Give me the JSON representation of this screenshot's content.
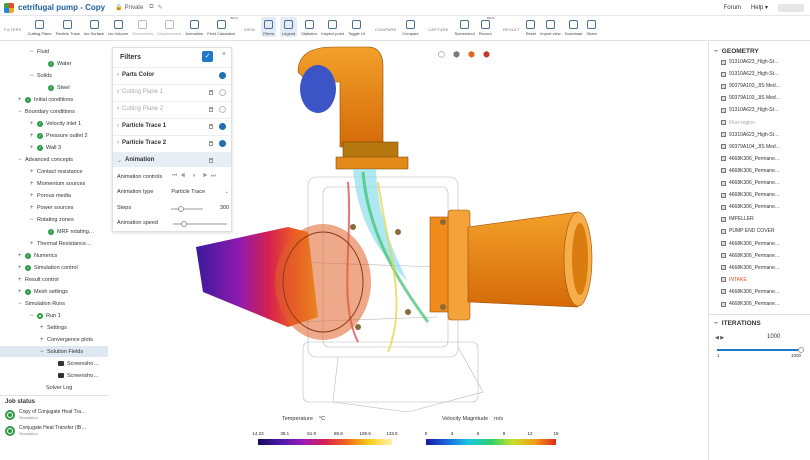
{
  "app": {
    "title": "cetrifugal pump - Copy",
    "privacy": "Private",
    "forum": "Forum",
    "help": "Help ▾"
  },
  "toolbar": {
    "filters_label": "FILTERS",
    "filters": [
      "Cutting Plane",
      "Particle Trace",
      "Iso Surface",
      "Iso Volume",
      "Streamlines",
      "Displacement",
      "Animation",
      "Field Calculator"
    ],
    "view_label": "VIEW",
    "view": [
      "Filters",
      "Legend",
      "Statistics",
      "Inspect point",
      "Toggle UI"
    ],
    "compare_label": "COMPARE",
    "compare": [
      "Compare"
    ],
    "capture_label": "CAPTURE",
    "capture": [
      "Screenshot",
      "Record"
    ],
    "result_label": "RESULT",
    "result": [
      "Reset",
      "Import view",
      "Download",
      "Share"
    ],
    "beta": "BETA"
  },
  "tree": [
    "Fluid",
    "Water",
    "Solids",
    "Steel",
    "Initial conditions",
    "Boundary conditions",
    "Velocity inlet 1",
    "Pressure outlet 2",
    "Wall 3",
    "Advanced concepts",
    "Contact resistance",
    "Momentum sources",
    "Porous media",
    "Power sources",
    "Rotating zones",
    "MRF rotating…",
    "Thermal Resistance…",
    "Numerics",
    "Simulation control",
    "Result control",
    "Mesh settings",
    "Simulation Runs",
    "Run 1",
    "Settings",
    "Convergence plots",
    "Solution Fields",
    "Screensho…",
    "Screensho…",
    "Solver Log"
  ],
  "jobs": {
    "title": "Job status",
    "items": [
      {
        "name": "Copy of Conjugate Heat Tra…",
        "type": "Simulation"
      },
      {
        "name": "Conjugate Heat Transfer (IB…",
        "type": "Simulation"
      }
    ]
  },
  "filters_panel": {
    "title": "Filters",
    "ok": "✓",
    "close": "×",
    "rows": [
      "Parts Color",
      "Cutting Plane 1",
      "Cutting Plane 2",
      "Particle Trace 1",
      "Particle Trace 2",
      "Animation"
    ],
    "animation_controls": "Animation controls",
    "animation_type_label": "Animation type",
    "animation_type": "Particle Trace",
    "steps_label": "Steps",
    "steps": "300",
    "steps_fraction": 0.3,
    "speed_label": "Animation speed",
    "speed_fraction": 0.2
  },
  "geometry": {
    "title": "GEOMETRY",
    "items": [
      "91310A623_High-St…",
      "91310A623_High-St…",
      "90379A103_JIS Med…",
      "90379A103_JIS Med…",
      "91310A623_High-St…",
      "Flow region",
      "91310A623_High-St…",
      "90379A104_JIS Med…",
      "4668K306_Permane…",
      "4668K306_Permane…",
      "4668K306_Permane…",
      "4668K306_Permane…",
      "4668K306_Permane…",
      "IMPELLER",
      "PUMP END COVER",
      "4668K306_Permane…",
      "4668K306_Permane…",
      "4668K306_Permane…",
      "INTAKE",
      "4668K306_Permane…",
      "4668K306_Permane…"
    ]
  },
  "iterations": {
    "title": "ITERATIONS",
    "value": "1000",
    "min": "1",
    "max": "1000",
    "fraction": 1.0
  },
  "legend_temp": {
    "label": "Temperature",
    "unit": "°C",
    "ticks": [
      "14.23",
      "38.1",
      "61.9",
      "85.8",
      "109.6",
      "133.5"
    ]
  },
  "legend_vel": {
    "label": "Velocity Magnitude",
    "unit": "m/s",
    "ticks": [
      "0",
      "3",
      "6",
      "9",
      "12",
      "15"
    ]
  },
  "colors": {
    "accent": "#1e7ac8",
    "pipe": "#f08a1c",
    "green": "#2e9b45"
  }
}
